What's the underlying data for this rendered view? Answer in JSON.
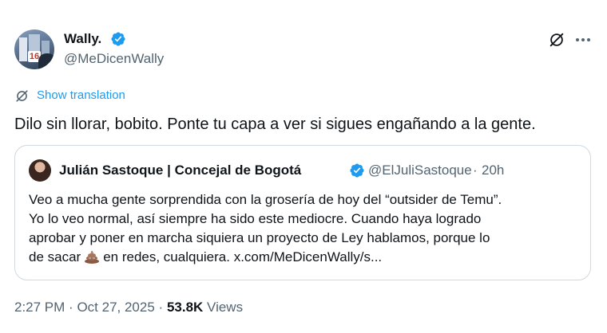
{
  "author": {
    "name": "Wally.",
    "handle": "@MeDicenWally",
    "avatar_badge": "16"
  },
  "translation": {
    "label": "Show translation"
  },
  "tweet": {
    "text": "Dilo sin llorar, bobito. Ponte tu capa a ver si sigues engañando a la gente."
  },
  "quoted": {
    "name": "Julián Sastoque | Concejal de Bogotá",
    "handle": "@ElJuliSastoque",
    "separator": "·",
    "time": "20h",
    "lines": [
      "Veo a mucha gente sorprendida con la grosería de hoy del “outsider de Temu”.",
      "Yo lo veo normal, así siempre ha sido este mediocre. Cuando haya logrado",
      "aprobar y poner en marcha siquiera un proyecto de Ley hablamos, porque lo",
      "de sacar"
    ],
    "line_end": "en redes, cualquiera. x.com/MeDicenWally/s..."
  },
  "meta": {
    "time": "2:27 PM",
    "sep1": "·",
    "date": "Oct 27, 2025",
    "sep2": "·",
    "views_count": "53.8K",
    "views_label": "Views"
  },
  "colors": {
    "accent": "#1d9bf0",
    "text": "#0f1419",
    "secondary": "#536471",
    "border": "#cfd9de"
  },
  "icons": [
    "verified-icon",
    "grok-icon",
    "more-icon",
    "translate-icon",
    "poop-emoji-icon"
  ]
}
